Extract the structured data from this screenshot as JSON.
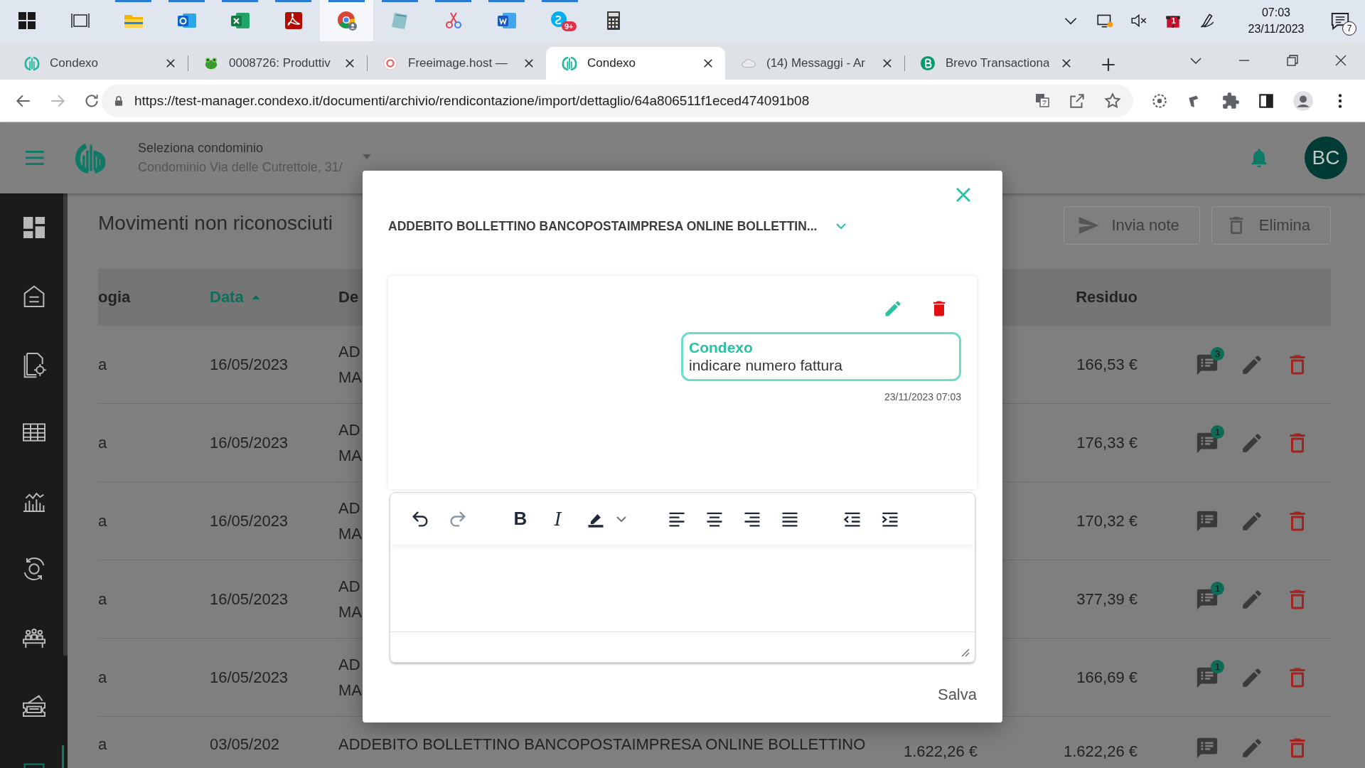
{
  "taskbar": {
    "apps": [
      {
        "kind": "windows-start",
        "selected": false,
        "running": false
      },
      {
        "kind": "task-view",
        "selected": false,
        "running": false
      },
      {
        "kind": "file-explorer",
        "selected": false,
        "running": true
      },
      {
        "kind": "mail",
        "selected": false,
        "running": true
      },
      {
        "kind": "spreadsheet",
        "selected": false,
        "running": true
      },
      {
        "kind": "pdf",
        "selected": false,
        "running": true
      },
      {
        "kind": "browser",
        "selected": true,
        "running": true
      },
      {
        "kind": "notes",
        "selected": false,
        "running": true
      },
      {
        "kind": "snipping",
        "selected": false,
        "running": true
      },
      {
        "kind": "word-processor",
        "selected": false,
        "running": true
      },
      {
        "kind": "chat",
        "selected": false,
        "running": true,
        "badge": "9+"
      },
      {
        "kind": "calculator",
        "selected": false,
        "running": false
      }
    ],
    "tray": [
      {
        "kind": "chevron"
      },
      {
        "kind": "display"
      },
      {
        "kind": "volume-muted"
      },
      {
        "kind": "gift",
        "badge": "1"
      },
      {
        "kind": "pen"
      }
    ],
    "clock": {
      "time": "07:03",
      "date": "23/11/2023"
    },
    "notifications": {
      "count": "7"
    }
  },
  "browser": {
    "tabs": [
      {
        "kind": "condexo",
        "title": "Condexo",
        "selected": false
      },
      {
        "kind": "frog",
        "title": "0008726: Produttiv",
        "selected": false
      },
      {
        "kind": "ring",
        "title": "Freeimage.host —",
        "selected": false
      },
      {
        "kind": "condexo",
        "title": "Condexo",
        "selected": true
      },
      {
        "kind": "cloud",
        "title": "(14) Messaggi - Ar",
        "selected": false
      },
      {
        "kind": "green-dot",
        "title": "Brevo Transactiona",
        "selected": false
      }
    ],
    "address": {
      "url": "https://test-manager.condexo.it/documenti/archivio/rendicontazione/import/dettaglio/64a806511f1eced474091b08"
    }
  },
  "header": {
    "label": "Seleziona condominio",
    "value": "Condominio Via delle Cutrettole, 31/",
    "avatar": "BC"
  },
  "sidebar": {
    "items": [
      {
        "kind": "dashboard",
        "selected": false
      },
      {
        "kind": "building",
        "selected": false
      },
      {
        "kind": "document-gear",
        "selected": false
      },
      {
        "kind": "table",
        "selected": false
      },
      {
        "kind": "chart",
        "selected": false
      },
      {
        "kind": "euro-cycle",
        "selected": false
      },
      {
        "kind": "meeting",
        "selected": false
      },
      {
        "kind": "ticket",
        "selected": false
      },
      {
        "kind": "report",
        "selected": true
      }
    ]
  },
  "page": {
    "title": "Movimenti non riconosciuti",
    "actions": [
      {
        "kind": "send",
        "label": "Invia note"
      },
      {
        "kind": "delete",
        "label": "Elimina"
      }
    ]
  },
  "table": {
    "columns": [
      {
        "label": "ogia",
        "sorted": false
      },
      {
        "label": "Data",
        "sorted": true
      },
      {
        "label": "De",
        "sorted": false
      },
      {
        "label": "Residuo",
        "sorted": false
      }
    ],
    "rows": [
      {
        "column_1": "a",
        "date": "16/05/2023",
        "description": [
          "AD",
          "MA"
        ],
        "residuo": "166,53 €",
        "notes_badge": "3"
      },
      {
        "column_1": "a",
        "date": "16/05/2023",
        "description": [
          "AD",
          "MA"
        ],
        "residuo": "176,33 €",
        "notes_badge": "1"
      },
      {
        "column_1": "a",
        "date": "16/05/2023",
        "description": [
          "AD",
          "MA"
        ],
        "residuo": "170,32 €"
      },
      {
        "column_1": "a",
        "date": "16/05/2023",
        "description": [
          "AD",
          "MA"
        ],
        "residuo": "377,39 €",
        "notes_badge": "1"
      },
      {
        "column_1": "a",
        "date": "16/05/2023",
        "description": [
          "AD",
          "MA"
        ],
        "residuo": "166,69 €",
        "notes_badge": "1"
      },
      {
        "column_1": "a",
        "date": "03/05/202",
        "description": [
          "ADDEBITO BOLLETTINO BANCOPOSTAIMPRESA ONLINE BOLLETTINO"
        ],
        "amount": "1.622,26 €",
        "residuo": "1.622,26 €"
      }
    ]
  },
  "modal": {
    "title": "ADDEBITO BOLLETTINO BANCOPOSTAIMPRESA ONLINE BOLLETTIN...",
    "notes": [
      {
        "author": "Condexo",
        "text": "indicare numero fattura",
        "time": "23/11/2023 07:03"
      }
    ],
    "toolbar": [
      [
        {
          "kind": "undo",
          "disabled": false
        },
        {
          "kind": "redo",
          "disabled": true
        }
      ],
      [
        {
          "kind": "bold",
          "label": "B"
        },
        {
          "kind": "italic",
          "label": "I"
        },
        {
          "kind": "highlight"
        },
        {
          "kind": "dropdown"
        }
      ],
      [
        {
          "kind": "align-left"
        },
        {
          "kind": "align-center"
        },
        {
          "kind": "align-right"
        },
        {
          "kind": "justify"
        }
      ],
      [
        {
          "kind": "outdent"
        },
        {
          "kind": "indent"
        }
      ]
    ],
    "save": "Salva"
  }
}
